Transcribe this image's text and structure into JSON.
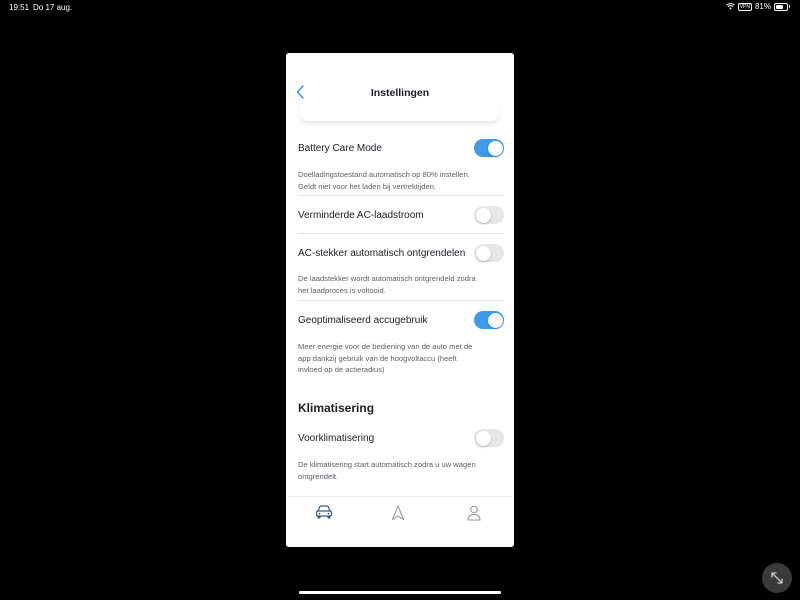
{
  "status_bar": {
    "time": "19:51",
    "date": "Do 17 aug.",
    "vpn": "VPN",
    "battery": "81%",
    "battery_level": 0.81
  },
  "header": {
    "title": "Instellingen",
    "back_icon": "chevron-left-icon"
  },
  "settings": [
    {
      "label": "Battery Care Mode",
      "enabled": true,
      "description": [
        "Doelladingstoestand automatisch op 80% instellen.",
        "Geldt niet voor het laden bij vertrektijden."
      ]
    },
    {
      "label": "Verminderde AC-laadstroom",
      "enabled": false,
      "description": []
    },
    {
      "label": "AC-stekker automatisch ontgrendelen",
      "enabled": false,
      "description": [
        "De laadstekker wordt automatisch ontgrendeld zodra",
        "het laadproces is voltooid."
      ]
    },
    {
      "label": "Geoptimaliseerd accugebruik",
      "enabled": true,
      "description": [
        "Meer energie voor de bediening van de auto met de",
        "app dankzij gebruik van de hoogvoltaccu (heeft",
        "invloed op de actieradius)"
      ]
    }
  ],
  "climate_section": {
    "title": "Klimatisering",
    "items": [
      {
        "label": "Voorklimatisering",
        "enabled": false,
        "description": [
          "De klimatisering start automatisch zodra u uw wagen",
          "ontgrendelt."
        ]
      }
    ]
  },
  "tab_bar": {
    "tabs": [
      {
        "icon": "car-icon",
        "active": true
      },
      {
        "icon": "navigation-icon",
        "active": false
      },
      {
        "icon": "user-icon",
        "active": false
      }
    ]
  },
  "colors": {
    "accent": "#3d9be9",
    "toggle_off": "#e6e7e9",
    "text": "#1b1e28",
    "secondary_text": "#5c6168"
  }
}
